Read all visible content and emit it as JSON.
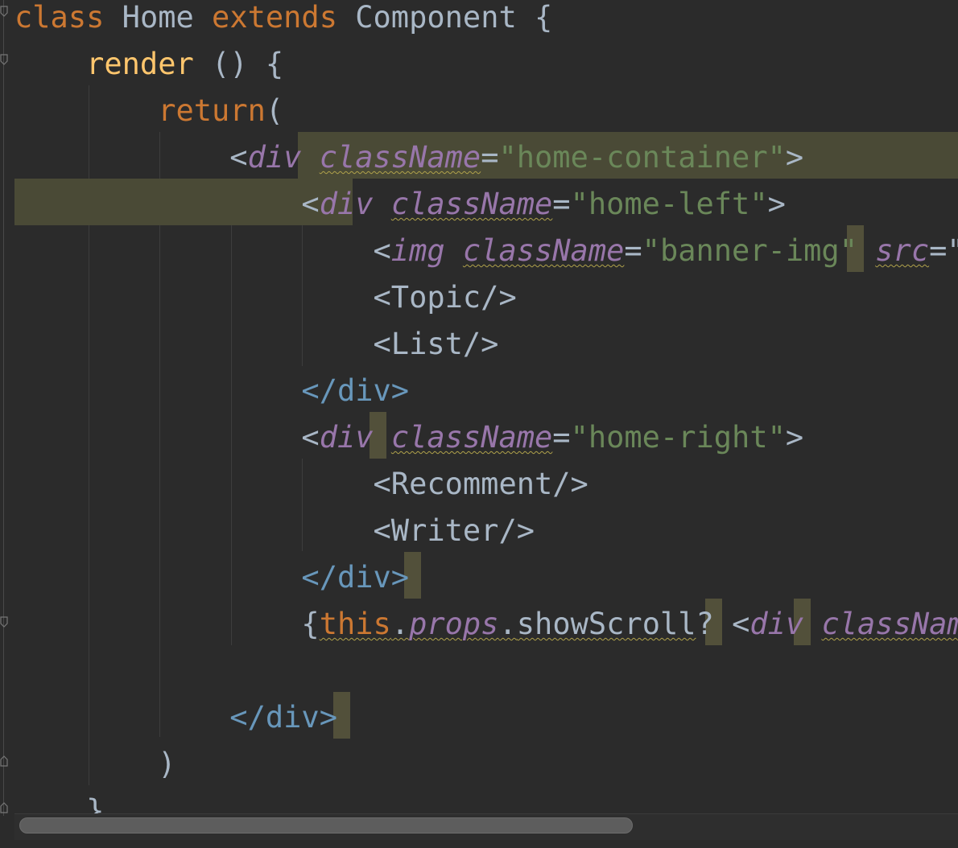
{
  "lines": [
    {
      "id": "l1",
      "tokens": [
        {
          "t": "class",
          "c": "kw"
        },
        {
          "t": " Home ",
          "c": "plain"
        },
        {
          "t": "extends",
          "c": "kw"
        },
        {
          "t": " Component {",
          "c": "plain"
        }
      ]
    },
    {
      "id": "l2",
      "tokens": [
        {
          "t": "    ",
          "c": "plain"
        },
        {
          "t": "render",
          "c": "fn"
        },
        {
          "t": " () {",
          "c": "plain"
        }
      ]
    },
    {
      "id": "l3",
      "tokens": [
        {
          "t": "        ",
          "c": "plain"
        },
        {
          "t": "return",
          "c": "kw"
        },
        {
          "t": "(",
          "c": "plain"
        }
      ]
    },
    {
      "id": "l4",
      "tokens": [
        {
          "t": "            <",
          "c": "plain"
        },
        {
          "t": "div",
          "c": "tag"
        },
        {
          "t": " ",
          "c": "plain"
        },
        {
          "t": "className",
          "c": "attr squig-y"
        },
        {
          "t": "=",
          "c": "plain"
        },
        {
          "t": "\"home-container\"",
          "c": "str"
        },
        {
          "t": ">",
          "c": "plain"
        }
      ]
    },
    {
      "id": "l5",
      "tokens": [
        {
          "t": "                <",
          "c": "plain"
        },
        {
          "t": "div",
          "c": "tag"
        },
        {
          "t": " ",
          "c": "plain"
        },
        {
          "t": "className",
          "c": "attr squig-y"
        },
        {
          "t": "=",
          "c": "plain"
        },
        {
          "t": "\"home-left\"",
          "c": "str"
        },
        {
          "t": ">",
          "c": "plain"
        }
      ]
    },
    {
      "id": "l6",
      "tokens": [
        {
          "t": "                    <",
          "c": "plain"
        },
        {
          "t": "img",
          "c": "tag"
        },
        {
          "t": " ",
          "c": "plain"
        },
        {
          "t": "className",
          "c": "attr squig-y"
        },
        {
          "t": "=",
          "c": "plain"
        },
        {
          "t": "\"banner-img\"",
          "c": "str"
        },
        {
          "t": " ",
          "c": "plain"
        },
        {
          "t": "src",
          "c": "attr squig-y"
        },
        {
          "t": "=\"/",
          "c": "plain"
        }
      ]
    },
    {
      "id": "l7",
      "tokens": [
        {
          "t": "                    <Topic/>",
          "c": "plain"
        }
      ]
    },
    {
      "id": "l8",
      "tokens": [
        {
          "t": "                    <List/>",
          "c": "plain"
        }
      ]
    },
    {
      "id": "l9",
      "tokens": [
        {
          "t": "                </",
          "c": "close-tag"
        },
        {
          "t": "div",
          "c": "close-tag"
        },
        {
          "t": ">",
          "c": "close-tag"
        }
      ]
    },
    {
      "id": "l10",
      "tokens": [
        {
          "t": "                <",
          "c": "plain"
        },
        {
          "t": "div",
          "c": "tag"
        },
        {
          "t": " ",
          "c": "plain"
        },
        {
          "t": "className",
          "c": "attr squig-y"
        },
        {
          "t": "=",
          "c": "plain"
        },
        {
          "t": "\"home-right\"",
          "c": "str"
        },
        {
          "t": ">",
          "c": "plain"
        }
      ]
    },
    {
      "id": "l11",
      "tokens": [
        {
          "t": "                    <Recomment/>",
          "c": "plain"
        }
      ]
    },
    {
      "id": "l12",
      "tokens": [
        {
          "t": "                    <Writer/>",
          "c": "plain"
        }
      ]
    },
    {
      "id": "l13",
      "tokens": [
        {
          "t": "                </",
          "c": "close-tag"
        },
        {
          "t": "div",
          "c": "close-tag"
        },
        {
          "t": ">",
          "c": "close-tag"
        }
      ]
    },
    {
      "id": "l14",
      "tokens": [
        {
          "t": "                {",
          "c": "plain"
        },
        {
          "t": "this",
          "c": "kw squig-y"
        },
        {
          "t": ".",
          "c": "plain squig-y"
        },
        {
          "t": "props",
          "c": "tag squig-y"
        },
        {
          "t": ".",
          "c": "plain squig-y"
        },
        {
          "t": "showScroll",
          "c": "plain squig-y"
        },
        {
          "t": "? <",
          "c": "plain"
        },
        {
          "t": "div",
          "c": "tag"
        },
        {
          "t": " ",
          "c": "plain"
        },
        {
          "t": "classNam",
          "c": "attr squig-y"
        },
        {
          "t": "e",
          "c": "attr squig-y"
        }
      ]
    },
    {
      "id": "l15",
      "tokens": [
        {
          "t": "",
          "c": "plain"
        }
      ]
    },
    {
      "id": "l16",
      "tokens": [
        {
          "t": "            </",
          "c": "close-tag"
        },
        {
          "t": "div",
          "c": "close-tag"
        },
        {
          "t": ">",
          "c": "close-tag"
        }
      ]
    },
    {
      "id": "l17",
      "tokens": [
        {
          "t": "        )",
          "c": "plain"
        }
      ]
    },
    {
      "id": "l18",
      "tokens": [
        {
          "t": "    }",
          "c": "plain"
        }
      ]
    }
  ],
  "colors": {
    "background": "#2b2b2b",
    "keyword": "#cc7832",
    "function": "#ffc66d",
    "tag": "#9876aa",
    "string": "#6a8759",
    "text": "#a9b7c6",
    "closing_tag": "#6897bb",
    "highlight": "#4a4a36"
  },
  "scrollbar": {
    "label": "horizontal-scrollbar"
  }
}
